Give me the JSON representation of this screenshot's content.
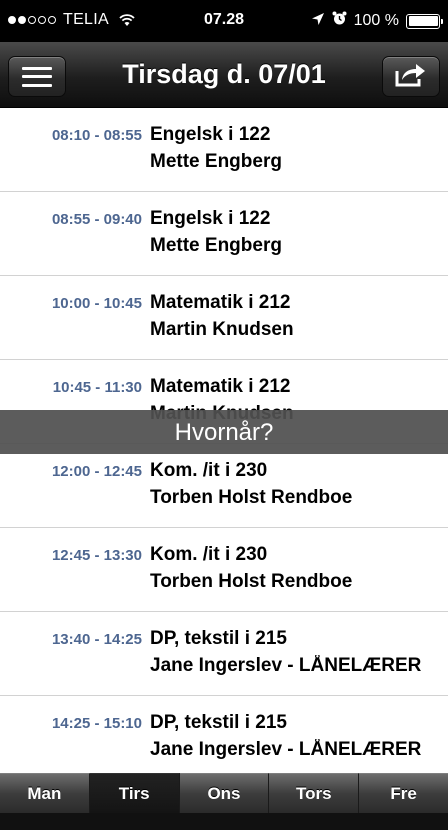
{
  "status_bar": {
    "carrier": "TELIA",
    "signal_bars_filled": 2,
    "signal_bars_total": 5,
    "time": "07.28",
    "battery": "100 %",
    "battery_level": 1.0
  },
  "nav": {
    "title": "Tirsdag d. 07/01",
    "left_icon": "menu-icon",
    "right_icon": "share-icon"
  },
  "lessons": [
    {
      "time": "08:10 - 08:55",
      "subject": "Engelsk i 122",
      "teacher": "Mette Engberg"
    },
    {
      "time": "08:55 - 09:40",
      "subject": "Engelsk i 122",
      "teacher": "Mette Engberg"
    },
    {
      "time": "10:00 - 10:45",
      "subject": "Matematik i 212",
      "teacher": "Martin Knudsen"
    },
    {
      "time": "10:45 - 11:30",
      "subject": "Matematik i 212",
      "teacher": "Martin Knudsen"
    },
    {
      "time": "12:00 - 12:45",
      "subject": "Kom. /it i 230",
      "teacher": "Torben Holst Rendboe"
    },
    {
      "time": "12:45 - 13:30",
      "subject": "Kom. /it i 230",
      "teacher": "Torben Holst Rendboe"
    },
    {
      "time": "13:40 - 14:25",
      "subject": "DP, tekstil i 215",
      "teacher": "Jane Ingerslev - LÅNELÆRER"
    },
    {
      "time": "14:25 - 15:10",
      "subject": "DP, tekstil i 215",
      "teacher": "Jane Ingerslev - LÅNELÆRER"
    }
  ],
  "toast": {
    "text": "Hvornår?"
  },
  "tabs": [
    {
      "label": "Man",
      "active": false
    },
    {
      "label": "Tirs",
      "active": true
    },
    {
      "label": "Ons",
      "active": false
    },
    {
      "label": "Tors",
      "active": false
    },
    {
      "label": "Fre",
      "active": false
    }
  ],
  "colors": {
    "time_text": "#4d6690",
    "nav_background": "#1e1e1e",
    "toast_background": "#505050"
  }
}
